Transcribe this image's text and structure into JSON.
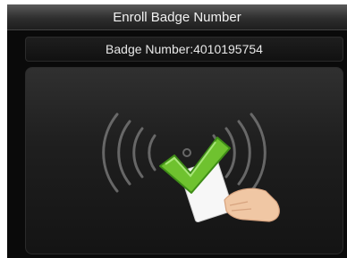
{
  "window": {
    "title": "Enroll Badge Number"
  },
  "badge": {
    "display": "Badge Number:4010195754"
  },
  "illustration": {
    "icon": "card-swipe-success",
    "check_color": "#6fc22f",
    "wave_color": "#7a7a7a"
  }
}
